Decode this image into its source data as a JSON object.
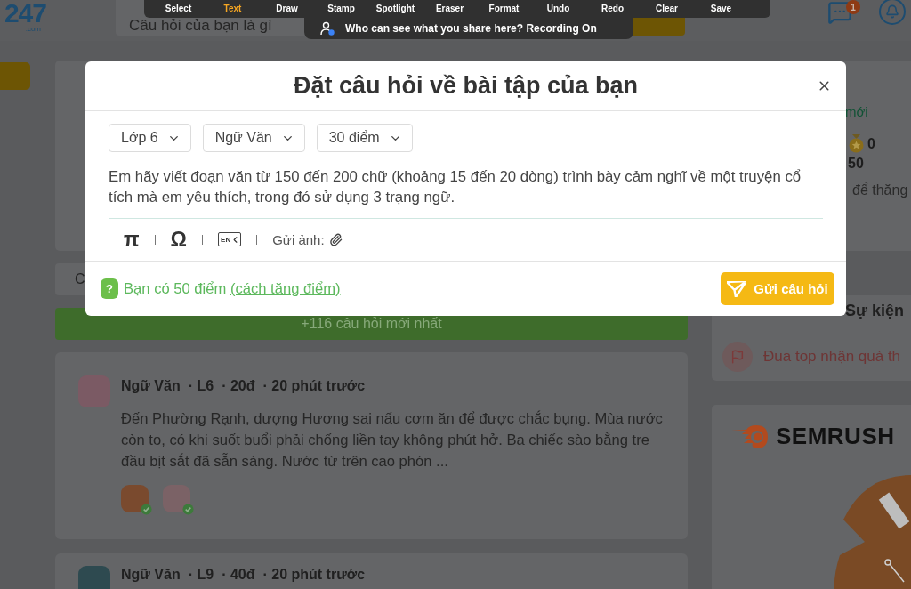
{
  "recorder": {
    "tools": [
      {
        "label": "Select",
        "selected": false
      },
      {
        "label": "Text",
        "selected": true
      },
      {
        "label": "Draw",
        "selected": false
      },
      {
        "label": "Stamp",
        "selected": false
      },
      {
        "label": "Spotlight",
        "selected": false
      },
      {
        "label": "Eraser",
        "selected": false
      },
      {
        "label": "Format",
        "selected": false
      },
      {
        "label": "Undo",
        "selected": false
      },
      {
        "label": "Redo",
        "selected": false
      },
      {
        "label": "Clear",
        "selected": false
      },
      {
        "label": "Save",
        "selected": false
      }
    ],
    "notice": "Who can see what you share here? Recording On"
  },
  "header": {
    "logo": "247",
    "logo_suffix": ".com",
    "search": {
      "placeholder": "Câu hỏi của bạn là gì"
    },
    "notification_badge": "1"
  },
  "feed": {
    "filter_bar": {
      "text": "C"
    },
    "new_questions": "+116 câu hỏi mới nhất",
    "questions": [
      {
        "meta": [
          "Ngữ Văn",
          "· L6",
          "· 20đ",
          "· 20 phút trước"
        ],
        "body": "Đến Phường Rạnh, dượng Hương sai nấu cơm ăn để được chắc bụng. Mùa nước còn to, có khi suốt buổi phải chống liền tay không phút hở. Ba chiếc sào bằng tre đầu bịt sắt đã sẵn sàng. Nước từ trên cao phón ...",
        "answers": [
          {
            "verified": true
          },
          {
            "verified": true
          }
        ]
      },
      {
        "meta": [
          "Ngữ Văn",
          "· L9",
          "· 40đ",
          "· 20 phút trước"
        ]
      }
    ]
  },
  "sidebar": {
    "profile": {
      "link": "mới",
      "stat": "0",
      "points": "50",
      "hint": "để thăng"
    },
    "events": {
      "title": "Sự kiện",
      "items": [
        {
          "label": "Đua top nhận quà th"
        }
      ]
    },
    "ad": {
      "brand": "SEMRUSH"
    }
  },
  "modal": {
    "title": "Đặt câu hỏi về bài tập của bạn",
    "selects": [
      {
        "value": "Lớp 6"
      },
      {
        "value": "Ngữ Văn"
      },
      {
        "value": "30 điểm"
      }
    ],
    "question": "Em hãy viết đoạn văn từ 150 đến 200 chữ (khoảng 15 đến 20 dòng) trình bày cảm nghĩ về một truyện cổ tích mà em yêu thích, trong đó sử dụng 3 trạng ngữ.",
    "tools": [
      {
        "kind": "symbol",
        "text": "π"
      },
      {
        "kind": "symbol",
        "text": "Ω"
      },
      {
        "kind": "keyboard",
        "text": "EN"
      },
      {
        "kind": "attach",
        "text": "Gửi ảnh:"
      }
    ],
    "help_icon": "?",
    "points_text": "Bạn có 50 điểm",
    "points_link": "(cách tăng điểm)",
    "submit": "Gửi câu hỏi"
  }
}
